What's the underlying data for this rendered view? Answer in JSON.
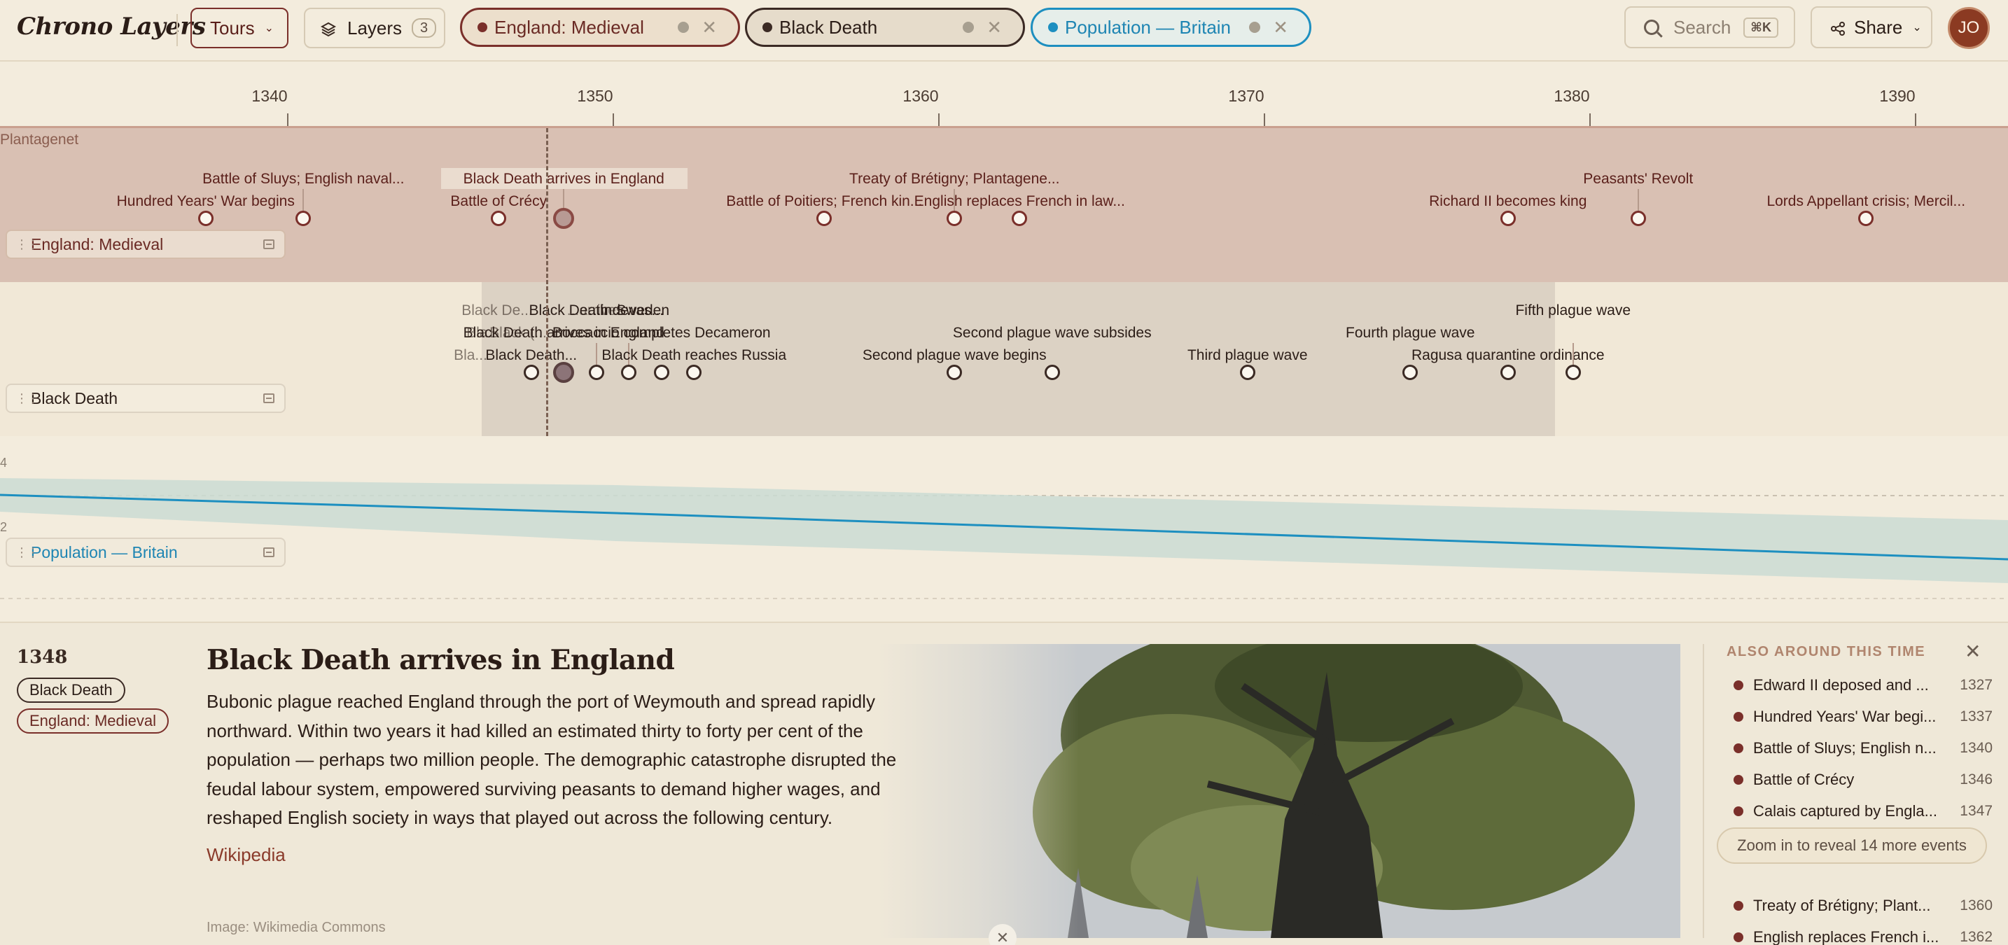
{
  "app": {
    "title": "Chrono Layers"
  },
  "toolbar": {
    "tours_label": "Tours",
    "layers_label": "Layers",
    "layers_count": "3",
    "search_placeholder": "Search",
    "search_shortcut": "⌘K",
    "share_label": "Share",
    "avatar_initials": "JO"
  },
  "layer_chips": [
    {
      "label": "England: Medieval",
      "color": "#7a2f2a"
    },
    {
      "label": "Black Death",
      "color": "#3b2a24"
    },
    {
      "label": "Population — Britain",
      "color": "#1d8fc0"
    }
  ],
  "axis": {
    "ticks": [
      "1340",
      "1350",
      "1360",
      "1370",
      "1380",
      "1390"
    ]
  },
  "tracks": {
    "medieval": {
      "label": "England: Medieval",
      "dynasty": "Plantagenet",
      "events": [
        {
          "label": "Hundred Years' War begins",
          "year": 1337
        },
        {
          "label": "Battle of Sluys; English naval...",
          "year": 1340
        },
        {
          "label": "Battle of Crécy",
          "year": 1346
        },
        {
          "label": "Black Death arrives in England",
          "year": 1348,
          "selected": true
        },
        {
          "label": "Battle of Poitiers; French kin...",
          "year": 1356
        },
        {
          "label": "Treaty of Brétigny; Plantagene...",
          "year": 1360
        },
        {
          "label": "English replaces French in law...",
          "year": 1362
        },
        {
          "label": "Richard II becomes king",
          "year": 1377
        },
        {
          "label": "Peasants' Revolt",
          "year": 1381
        },
        {
          "label": "Lords Appellant crisis; Mercil...",
          "year": 1388
        }
      ]
    },
    "blackdeath": {
      "label": "Black Death",
      "events": [
        {
          "label": "Black Death...",
          "year": 1347
        },
        {
          "label": "Black Death arrives in England",
          "year": 1348,
          "selected": true
        },
        {
          "label": "Black Death devas...",
          "year": 1349
        },
        {
          "label": "...in Sweden",
          "year": 1350
        },
        {
          "label": "Boccaccio completes Decameron",
          "year": 1351
        },
        {
          "label": "Black Death reaches Russia",
          "year": 1352
        },
        {
          "label": "Second plague wave begins",
          "year": 1360
        },
        {
          "label": "Second plague wave subsides",
          "year": 1363
        },
        {
          "label": "Third plague wave",
          "year": 1369
        },
        {
          "label": "Fourth plague wave",
          "year": 1374
        },
        {
          "label": "Ragusa quarantine ordinance",
          "year": 1377
        },
        {
          "label": "Fifth plague wave",
          "year": 1379
        }
      ],
      "overlap_labels": [
        "Black De...",
        "Bla...",
        "Bla...",
        "Black (...",
        "...arrives"
      ]
    },
    "population": {
      "label": "Population — Britain",
      "y_ticks": [
        "4",
        "2"
      ]
    }
  },
  "detail": {
    "year": "1348",
    "tags": [
      "Black Death",
      "England: Medieval"
    ],
    "title": "Black Death arrives in England",
    "body": "Bubonic plague reached England through the port of Weymouth and spread rapidly northward. Within two years it had killed an estimated thirty to forty per cent of the population — perhaps two million people. The demographic catastrophe disrupted the feudal labour system, empowered surviving peasants to demand higher wages, and reshaped English society in ways that played out across the following century.",
    "link_label": "Wikipedia",
    "image_credit": "Image: Wikimedia Commons"
  },
  "sidebar": {
    "heading": "ALSO AROUND THIS TIME",
    "items": [
      {
        "name": "Edward II deposed and ...",
        "year": "1327"
      },
      {
        "name": "Hundred Years' War begi...",
        "year": "1337"
      },
      {
        "name": "Battle of Sluys; English n...",
        "year": "1340"
      },
      {
        "name": "Battle of Crécy",
        "year": "1346"
      },
      {
        "name": "Calais captured by Engla...",
        "year": "1347"
      },
      {
        "name": "Treaty of Brétigny; Plant...",
        "year": "1360"
      },
      {
        "name": "English replaces French i...",
        "year": "1362"
      }
    ],
    "zoom_hint": "Zoom in to reveal 14 more events"
  },
  "colors": {
    "accent_medieval": "#7a2f2a",
    "accent_blackdeath": "#3b2a24",
    "accent_population": "#1d8fc0"
  }
}
